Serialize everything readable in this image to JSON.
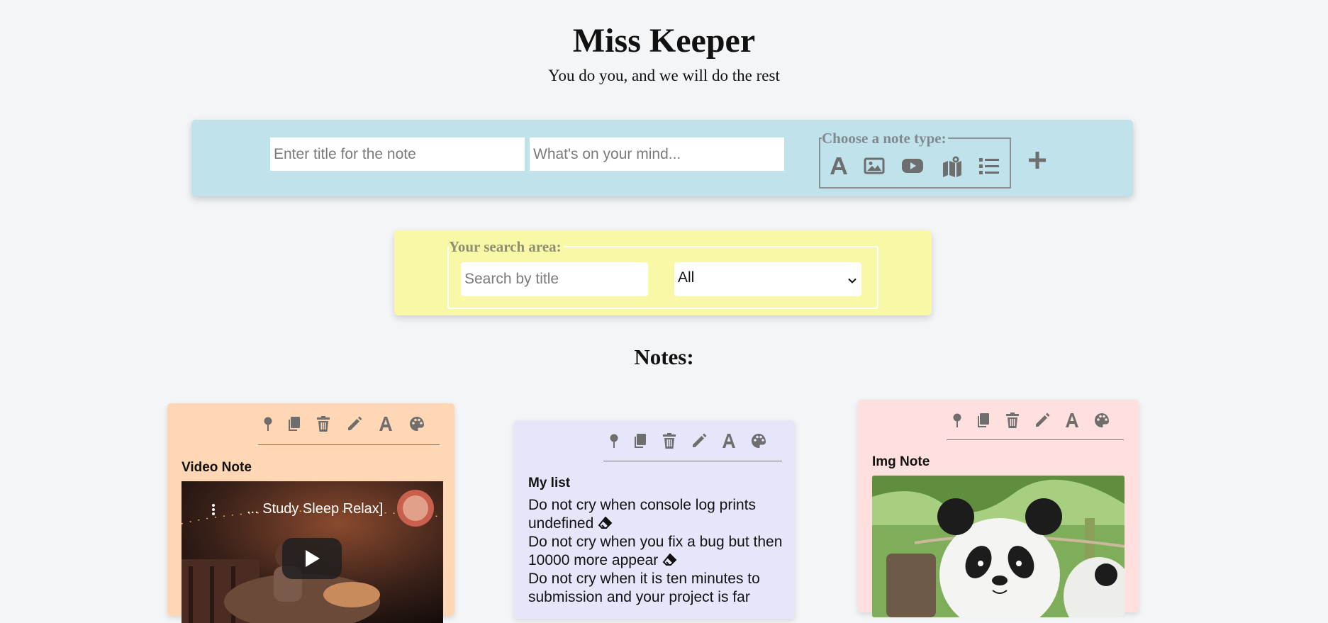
{
  "header": {
    "title": "Miss Keeper",
    "subtitle": "You do you, and we will do the rest"
  },
  "composer": {
    "title_placeholder": "Enter title for the note",
    "text_placeholder": "What's on your mind...",
    "type_legend": "Choose a note type:",
    "types": [
      "text-type-icon",
      "image-type-icon",
      "video-type-icon",
      "map-type-icon",
      "list-type-icon"
    ]
  },
  "search": {
    "legend": "Your search area:",
    "placeholder": "Search by title",
    "filter_value": "All"
  },
  "notes_heading": "Notes:",
  "notes": [
    {
      "title": "Video Note",
      "video_title": "... Study Sleep Relax]",
      "color": "#ffd7b5"
    },
    {
      "title": "My list",
      "items": [
        "Do not cry when console log prints undefined",
        "Do not cry when you fix a bug but then 10000 more appear",
        "Do not cry when it is ten minutes to submission and your project is far"
      ],
      "color": "#e6e6fa"
    },
    {
      "title": "Img Note",
      "color": "#ffe0df"
    }
  ],
  "tool_icons": [
    "pin-icon",
    "copy-icon",
    "trash-icon",
    "edit-icon",
    "font-icon",
    "palette-icon"
  ],
  "colors": {
    "background": "#f4f5f7",
    "composer": "#c0e2ea",
    "search_area": "#f8f8a7",
    "icon_gray": "#6e6e6e"
  }
}
